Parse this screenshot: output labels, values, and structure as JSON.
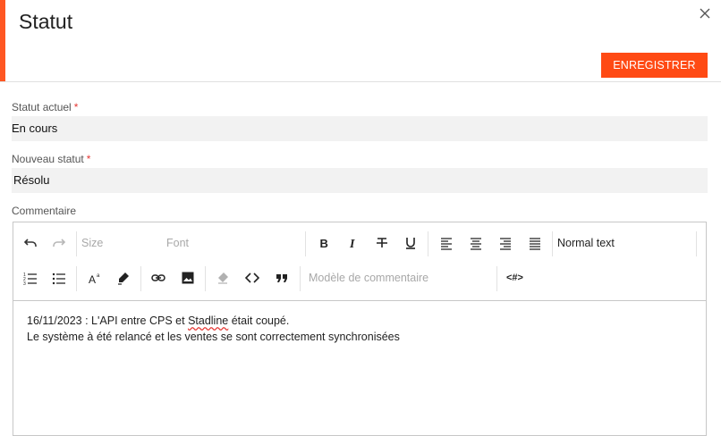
{
  "dialog": {
    "title": "Statut",
    "save_label": "ENREGISTRER",
    "accent_color": "#ff5722",
    "close_icon": "close-icon"
  },
  "fields": {
    "current_status": {
      "label": "Statut actuel",
      "required_mark": "*",
      "value": "En cours"
    },
    "new_status": {
      "label": "Nouveau statut",
      "required_mark": "*",
      "value": "Résolu"
    },
    "comment": {
      "label": "Commentaire"
    }
  },
  "toolbar": {
    "size_placeholder": "Size",
    "font_placeholder": "Font",
    "block_format": "Normal text",
    "template_placeholder": "Modèle de commentaire",
    "code_tag": "<#>"
  },
  "comment_lines": {
    "line1_prefix": "16/11/2023 : L'API entre CPS et ",
    "line1_misspelled": "Stadline",
    "line1_suffix": " était coupé.",
    "line2": "Le système à été relancé et les ventes se sont correctement synchronisées"
  }
}
